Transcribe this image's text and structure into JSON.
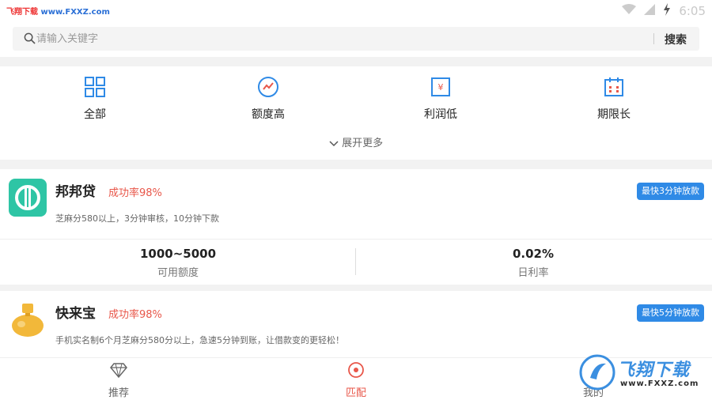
{
  "status_bar": {
    "watermark_left": "飞翔下载",
    "watermark_url": "www.FXXZ.com",
    "time": "6:05"
  },
  "search": {
    "placeholder": "请输入关键字",
    "button_label": "搜索"
  },
  "categories": [
    {
      "label": "全部",
      "icon": "grid-icon"
    },
    {
      "label": "额度高",
      "icon": "trend-circle-icon"
    },
    {
      "label": "利润低",
      "icon": "yen-doc-icon"
    },
    {
      "label": "期限长",
      "icon": "calendar-icon"
    }
  ],
  "expand_more": "展开更多",
  "products": [
    {
      "name": "邦邦贷",
      "success_rate": "成功率98%",
      "badge": "最快3分钟放款",
      "desc": "芝麻分580以上，3分钟审核，10分钟下款",
      "amount_value": "1000~5000",
      "amount_label": "可用额度",
      "rate_value": "0.02%",
      "rate_label": "日利率"
    },
    {
      "name": "快来宝",
      "success_rate": "成功率98%",
      "badge": "最快5分钟放款",
      "desc": "手机实名制6个月芝麻分580分以上，急速5分钟到账，让借款变的更轻松！"
    }
  ],
  "tabs": [
    {
      "label": "推荐",
      "icon": "diamond-icon"
    },
    {
      "label": "匹配",
      "icon": "target-icon"
    },
    {
      "label": "我的",
      "icon": "person-icon"
    }
  ],
  "watermark_br": {
    "title": "飞翔下载",
    "url": "www.FXXZ.com"
  },
  "colors": {
    "accent_blue": "#2f8ae6",
    "accent_red": "#e8574a",
    "logo_green": "#2ec5a5",
    "logo_gold": "#f2b83a"
  }
}
